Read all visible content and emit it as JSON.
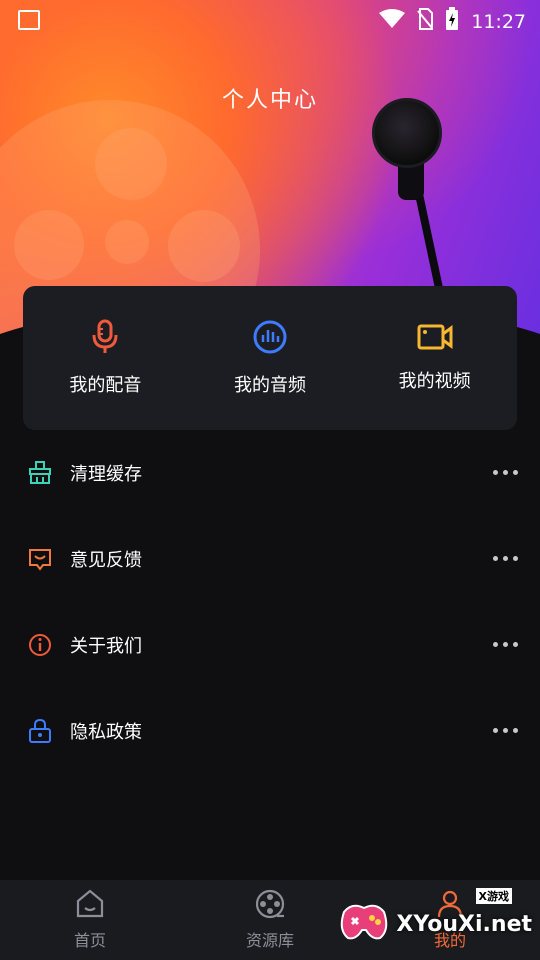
{
  "status_bar": {
    "time": "11:27"
  },
  "header": {
    "title": "个人中心"
  },
  "quick_actions": [
    {
      "label": "我的配音",
      "icon": "microphone-icon",
      "color": "#f05a3c"
    },
    {
      "label": "我的音频",
      "icon": "audio-wave-icon",
      "color": "#3d7cff"
    },
    {
      "label": "我的视频",
      "icon": "video-camera-icon",
      "color": "#f7b731"
    }
  ],
  "menu": [
    {
      "label": "清理缓存",
      "icon": "broom-icon",
      "color": "#3fd1b5"
    },
    {
      "label": "意见反馈",
      "icon": "feedback-icon",
      "color": "#f07a3c"
    },
    {
      "label": "关于我们",
      "icon": "info-icon",
      "color": "#f05a3c"
    },
    {
      "label": "隐私政策",
      "icon": "lock-icon",
      "color": "#3d7cff"
    }
  ],
  "tabbar": [
    {
      "label": "首页",
      "icon": "home-icon"
    },
    {
      "label": "资源库",
      "icon": "film-reel-icon"
    },
    {
      "label": "我的",
      "icon": "profile-icon",
      "active": true
    }
  ],
  "watermark": {
    "text": "XYouXi.net",
    "tag": "X游戏"
  }
}
